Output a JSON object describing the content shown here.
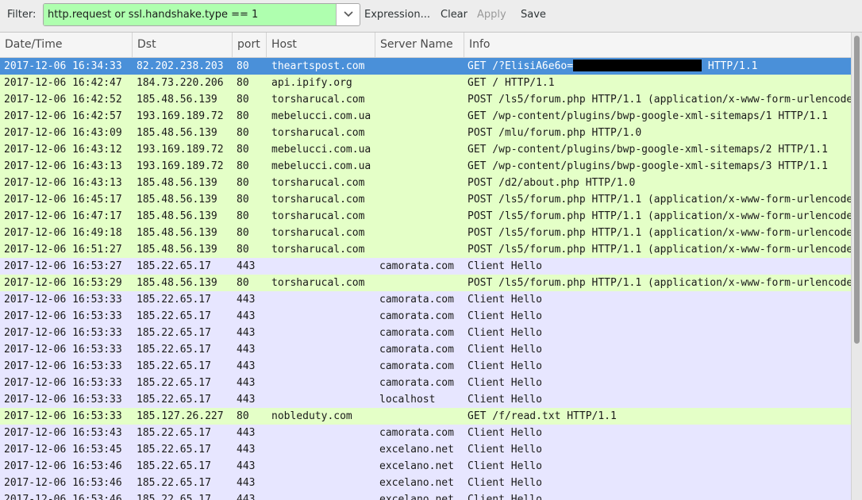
{
  "toolbar": {
    "filter_label": "Filter:",
    "filter_value": "http.request or ssl.handshake.type == 1",
    "expression_label": "Expression...",
    "clear_label": "Clear",
    "apply_label": "Apply",
    "save_label": "Save"
  },
  "columns": [
    "Date/Time",
    "Dst",
    "port",
    "Host",
    "Server Name",
    "Info"
  ],
  "colors": {
    "http_row": "#e4ffc7",
    "tls_row": "#e7e6ff",
    "selected_row": "#4a90d9",
    "filter_valid": "#afffaf"
  },
  "packets": [
    {
      "time": "2017-12-06 16:34:33",
      "dst": "82.202.238.203",
      "port": "80",
      "host": "theartspost.com",
      "sni": "",
      "info": "GET /?ElisiA6e6o=",
      "info_tail": " HTTP/1.1",
      "redacted": true,
      "kind": "http",
      "selected": true
    },
    {
      "time": "2017-12-06 16:42:47",
      "dst": "184.73.220.206",
      "port": "80",
      "host": "api.ipify.org",
      "sni": "",
      "info": "GET / HTTP/1.1",
      "kind": "http"
    },
    {
      "time": "2017-12-06 16:42:52",
      "dst": "185.48.56.139",
      "port": "80",
      "host": "torsharucal.com",
      "sni": "",
      "info": "POST /ls5/forum.php HTTP/1.1  (application/x-www-form-urlencoded)",
      "kind": "http"
    },
    {
      "time": "2017-12-06 16:42:57",
      "dst": "193.169.189.72",
      "port": "80",
      "host": "mebelucci.com.ua",
      "sni": "",
      "info": "GET /wp-content/plugins/bwp-google-xml-sitemaps/1 HTTP/1.1",
      "kind": "http"
    },
    {
      "time": "2017-12-06 16:43:09",
      "dst": "185.48.56.139",
      "port": "80",
      "host": "torsharucal.com",
      "sni": "",
      "info": "POST /mlu/forum.php HTTP/1.0",
      "kind": "http"
    },
    {
      "time": "2017-12-06 16:43:12",
      "dst": "193.169.189.72",
      "port": "80",
      "host": "mebelucci.com.ua",
      "sni": "",
      "info": "GET /wp-content/plugins/bwp-google-xml-sitemaps/2 HTTP/1.1",
      "kind": "http"
    },
    {
      "time": "2017-12-06 16:43:13",
      "dst": "193.169.189.72",
      "port": "80",
      "host": "mebelucci.com.ua",
      "sni": "",
      "info": "GET /wp-content/plugins/bwp-google-xml-sitemaps/3 HTTP/1.1",
      "kind": "http"
    },
    {
      "time": "2017-12-06 16:43:13",
      "dst": "185.48.56.139",
      "port": "80",
      "host": "torsharucal.com",
      "sni": "",
      "info": "POST /d2/about.php HTTP/1.0",
      "kind": "http"
    },
    {
      "time": "2017-12-06 16:45:17",
      "dst": "185.48.56.139",
      "port": "80",
      "host": "torsharucal.com",
      "sni": "",
      "info": "POST /ls5/forum.php HTTP/1.1  (application/x-www-form-urlencoded)",
      "kind": "http"
    },
    {
      "time": "2017-12-06 16:47:17",
      "dst": "185.48.56.139",
      "port": "80",
      "host": "torsharucal.com",
      "sni": "",
      "info": "POST /ls5/forum.php HTTP/1.1  (application/x-www-form-urlencoded)",
      "kind": "http"
    },
    {
      "time": "2017-12-06 16:49:18",
      "dst": "185.48.56.139",
      "port": "80",
      "host": "torsharucal.com",
      "sni": "",
      "info": "POST /ls5/forum.php HTTP/1.1  (application/x-www-form-urlencoded)",
      "kind": "http"
    },
    {
      "time": "2017-12-06 16:51:27",
      "dst": "185.48.56.139",
      "port": "80",
      "host": "torsharucal.com",
      "sni": "",
      "info": "POST /ls5/forum.php HTTP/1.1  (application/x-www-form-urlencoded)",
      "kind": "http"
    },
    {
      "time": "2017-12-06 16:53:27",
      "dst": "185.22.65.17",
      "port": "443",
      "host": "",
      "sni": "camorata.com",
      "info": "Client Hello",
      "kind": "tls"
    },
    {
      "time": "2017-12-06 16:53:29",
      "dst": "185.48.56.139",
      "port": "80",
      "host": "torsharucal.com",
      "sni": "",
      "info": "POST /ls5/forum.php HTTP/1.1  (application/x-www-form-urlencoded)",
      "kind": "http"
    },
    {
      "time": "2017-12-06 16:53:33",
      "dst": "185.22.65.17",
      "port": "443",
      "host": "",
      "sni": "camorata.com",
      "info": "Client Hello",
      "kind": "tls"
    },
    {
      "time": "2017-12-06 16:53:33",
      "dst": "185.22.65.17",
      "port": "443",
      "host": "",
      "sni": "camorata.com",
      "info": "Client Hello",
      "kind": "tls"
    },
    {
      "time": "2017-12-06 16:53:33",
      "dst": "185.22.65.17",
      "port": "443",
      "host": "",
      "sni": "camorata.com",
      "info": "Client Hello",
      "kind": "tls"
    },
    {
      "time": "2017-12-06 16:53:33",
      "dst": "185.22.65.17",
      "port": "443",
      "host": "",
      "sni": "camorata.com",
      "info": "Client Hello",
      "kind": "tls"
    },
    {
      "time": "2017-12-06 16:53:33",
      "dst": "185.22.65.17",
      "port": "443",
      "host": "",
      "sni": "camorata.com",
      "info": "Client Hello",
      "kind": "tls"
    },
    {
      "time": "2017-12-06 16:53:33",
      "dst": "185.22.65.17",
      "port": "443",
      "host": "",
      "sni": "camorata.com",
      "info": "Client Hello",
      "kind": "tls"
    },
    {
      "time": "2017-12-06 16:53:33",
      "dst": "185.22.65.17",
      "port": "443",
      "host": "",
      "sni": "localhost",
      "info": "Client Hello",
      "kind": "tls"
    },
    {
      "time": "2017-12-06 16:53:33",
      "dst": "185.127.26.227",
      "port": "80",
      "host": "nobleduty.com",
      "sni": "",
      "info": "GET /f/read.txt HTTP/1.1",
      "kind": "http"
    },
    {
      "time": "2017-12-06 16:53:43",
      "dst": "185.22.65.17",
      "port": "443",
      "host": "",
      "sni": "camorata.com",
      "info": "Client Hello",
      "kind": "tls"
    },
    {
      "time": "2017-12-06 16:53:45",
      "dst": "185.22.65.17",
      "port": "443",
      "host": "",
      "sni": "excelano.net",
      "info": "Client Hello",
      "kind": "tls"
    },
    {
      "time": "2017-12-06 16:53:46",
      "dst": "185.22.65.17",
      "port": "443",
      "host": "",
      "sni": "excelano.net",
      "info": "Client Hello",
      "kind": "tls"
    },
    {
      "time": "2017-12-06 16:53:46",
      "dst": "185.22.65.17",
      "port": "443",
      "host": "",
      "sni": "excelano.net",
      "info": "Client Hello",
      "kind": "tls"
    },
    {
      "time": "2017-12-06 16:53:46",
      "dst": "185.22.65.17",
      "port": "443",
      "host": "",
      "sni": "excelano.net",
      "info": "Client Hello",
      "kind": "tls"
    }
  ]
}
